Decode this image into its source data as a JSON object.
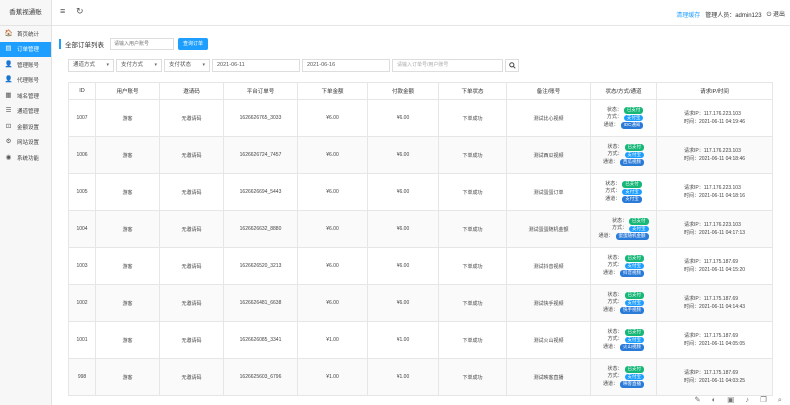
{
  "app": {
    "logo": "香蕉视通账"
  },
  "sidebar": {
    "items": [
      {
        "label": "首页统计",
        "icon": "home-icon",
        "glyph": "🏠"
      },
      {
        "label": "订单管理",
        "icon": "order-icon",
        "glyph": "▤"
      },
      {
        "label": "管理账号",
        "icon": "user-icon",
        "glyph": "👤"
      },
      {
        "label": "代理账号",
        "icon": "user-icon",
        "glyph": "👤"
      },
      {
        "label": "域名管理",
        "icon": "grid-icon",
        "glyph": "▦"
      },
      {
        "label": "通道管理",
        "icon": "list-icon",
        "glyph": "☰"
      },
      {
        "label": "金额设置",
        "icon": "money-icon",
        "glyph": "⊡"
      },
      {
        "label": "网站设置",
        "icon": "gear-icon",
        "glyph": "⚙"
      },
      {
        "label": "系统功能",
        "icon": "settings-icon",
        "glyph": "◉"
      }
    ]
  },
  "topbar": {
    "clear_cache": "清理缓存",
    "admin_label": "管理人员：admin123",
    "logout": "退出"
  },
  "main": {
    "title": "全部订单列表",
    "user_placeholder": "请输入用户账号",
    "query_button": "查询订单",
    "filters": {
      "channel": "通道方式",
      "pay_method": "支付方式",
      "pay_status": "支付状态",
      "date_from": "2021-06-11",
      "date_to": "2021-06-16",
      "search_placeholder": "请输入订单号/用户账号"
    },
    "columns": [
      "ID",
      "用户账号",
      "邀请码",
      "平台订单号",
      "下单金额",
      "付款金额",
      "下单状态",
      "备注/账号",
      "状态/方式/通道",
      "请求IP/时间"
    ],
    "status_labels": {
      "status": "状态：",
      "method": "方式：",
      "channel": "通道："
    },
    "rows": [
      {
        "id": "1007",
        "user": "游客",
        "invite": "无邀请码",
        "order_no": "1626626765_3033",
        "order_amount": "¥6.00",
        "pay_amount": "¥6.00",
        "order_status": "下单成功",
        "remark": "测试比心视频",
        "status_badge": "已支付",
        "method_badge": "支付宝",
        "channel_badge": "IDC通知",
        "ip": "请求IP：117.176.223.103",
        "time": "时间：2021-06-11 04:19:46"
      },
      {
        "id": "1006",
        "user": "游客",
        "invite": "无邀请码",
        "order_no": "1626626724_7457",
        "order_amount": "¥6.00",
        "pay_amount": "¥6.00",
        "order_status": "下单成功",
        "remark": "测试西瓜视频",
        "status_badge": "已支付",
        "method_badge": "支付宝",
        "channel_badge": "西瓜视频",
        "ip": "请求IP：117.176.223.103",
        "time": "时间：2021-06-11 04:18:46"
      },
      {
        "id": "1005",
        "user": "游客",
        "invite": "无邀请码",
        "order_no": "1626626694_5443",
        "order_amount": "¥6.00",
        "pay_amount": "¥6.00",
        "order_status": "下单成功",
        "remark": "测试蛋蛋订单",
        "status_badge": "已支付",
        "method_badge": "支付宝",
        "channel_badge": "支付宝",
        "ip": "请求IP：117.176.223.103",
        "time": "时间：2021-06-11 04:18:16"
      },
      {
        "id": "1004",
        "user": "游客",
        "invite": "无邀请码",
        "order_no": "1626626632_8880",
        "order_amount": "¥6.00",
        "pay_amount": "¥6.00",
        "order_status": "下单成功",
        "remark": "测试蛋蛋随机金额",
        "status_badge": "已支付",
        "method_badge": "支付宝",
        "channel_badge": "蛋蛋随机金额",
        "ip": "请求IP：117.176.223.103",
        "time": "时间：2021-06-11 04:17:13"
      },
      {
        "id": "1003",
        "user": "游客",
        "invite": "无邀请码",
        "order_no": "1626626520_3213",
        "order_amount": "¥6.00",
        "pay_amount": "¥6.00",
        "order_status": "下单成功",
        "remark": "测试抖音视频",
        "status_badge": "已支付",
        "method_badge": "支付宝",
        "channel_badge": "抖音视频",
        "ip": "请求IP：117.175.187.69",
        "time": "时间：2021-06-11 04:15:20"
      },
      {
        "id": "1002",
        "user": "游客",
        "invite": "无邀请码",
        "order_no": "1626626481_6638",
        "order_amount": "¥6.00",
        "pay_amount": "¥6.00",
        "order_status": "下单成功",
        "remark": "测试快手视频",
        "status_badge": "已支付",
        "method_badge": "支付宝",
        "channel_badge": "快手视频",
        "ip": "请求IP：117.175.187.69",
        "time": "时间：2021-06-11 04:14:43"
      },
      {
        "id": "1001",
        "user": "游客",
        "invite": "无邀请码",
        "order_no": "1626626085_3341",
        "order_amount": "¥1.00",
        "pay_amount": "¥1.00",
        "order_status": "下单成功",
        "remark": "测试火山视频",
        "status_badge": "已支付",
        "method_badge": "支付宝",
        "channel_badge": "火山视频",
        "ip": "请求IP：117.175.187.69",
        "time": "时间：2021-06-11 04:05:05"
      },
      {
        "id": "998",
        "user": "游客",
        "invite": "无邀请码",
        "order_no": "1626625603_6796",
        "order_amount": "¥1.00",
        "pay_amount": "¥1.00",
        "order_status": "下单成功",
        "remark": "测试映客直播",
        "status_badge": "已支付",
        "method_badge": "支付宝",
        "channel_badge": "映客直播",
        "ip": "请求IP：117.175.187.69",
        "time": "时间：2021-06-11 04:03:25"
      }
    ]
  },
  "colors": {
    "accent": "#1e9fff",
    "success": "#16b777",
    "channel": "#2a7ad8"
  }
}
